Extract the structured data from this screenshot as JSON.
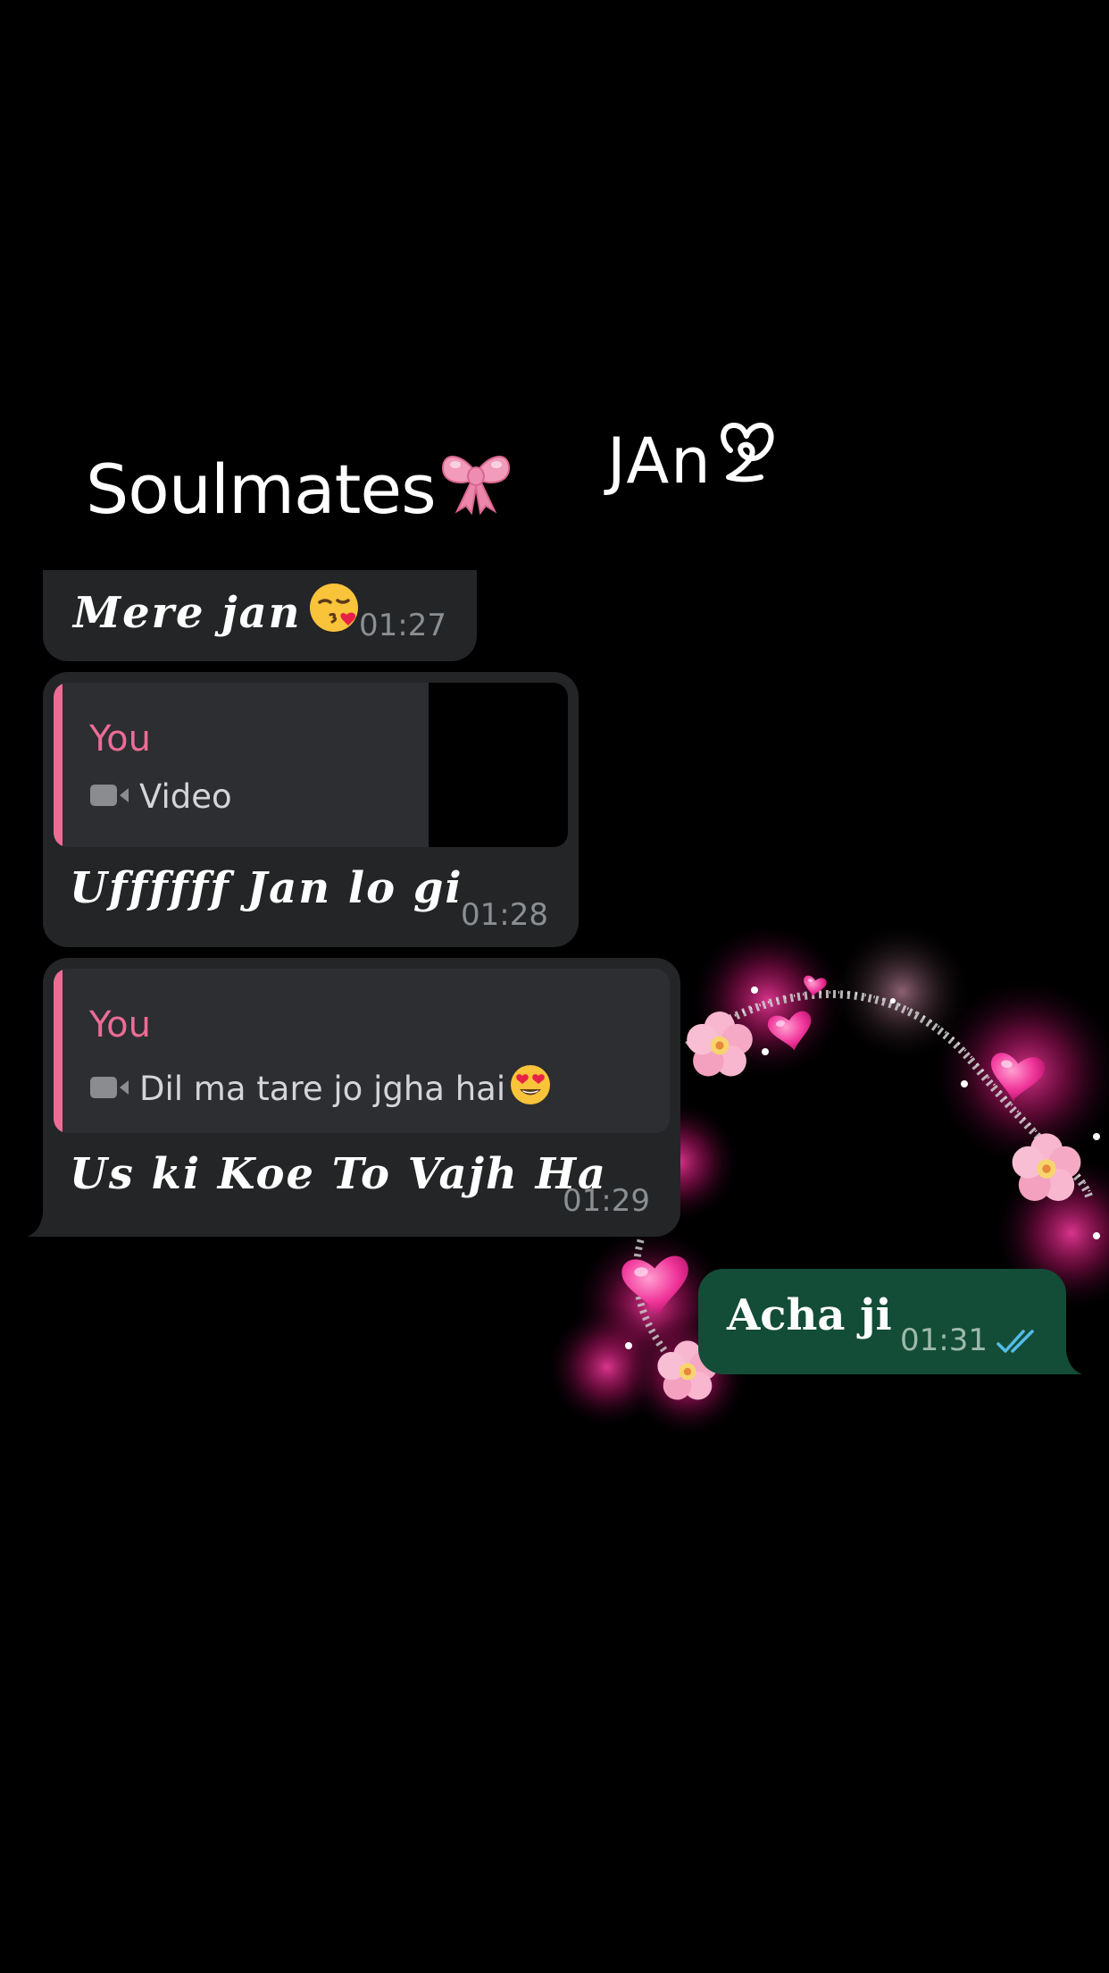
{
  "header": {
    "left_title": "Soulmates",
    "left_title_icon": "ribbon-bow-icon",
    "right_title": "JAn",
    "right_title_icon": "loop-heart-icon"
  },
  "messages": [
    {
      "direction": "incoming",
      "text": "Mere jan",
      "emoji": "kissing-face-icon",
      "time": "01:27"
    },
    {
      "direction": "incoming",
      "reply": {
        "author": "You",
        "media_icon": "video-camera-icon",
        "preview_text": "Video"
      },
      "text": "Uffffff Jan lo gi",
      "time": "01:28"
    },
    {
      "direction": "incoming",
      "reply": {
        "author": "You",
        "media_icon": "video-camera-icon",
        "preview_text": "Dil ma tare jo jgha hai",
        "preview_emoji": "heart-eyes-face-icon"
      },
      "text": "Us ki Koe To Vajh Ha",
      "time": "01:29"
    },
    {
      "direction": "outgoing",
      "text": "Acha ji",
      "time": "01:31",
      "status_icon": "double-check-read-icon"
    }
  ],
  "colors": {
    "background": "#000000",
    "incoming_bubble": "#232527",
    "outgoing_bubble": "#144d37",
    "reply_accent": "#ec6c95",
    "read_ticks": "#53bdeb"
  },
  "decoration": {
    "name": "pink-heart-flower-wreath",
    "elements": [
      "heart-icon",
      "sakura-flower-icon",
      "glitter-arc"
    ]
  }
}
